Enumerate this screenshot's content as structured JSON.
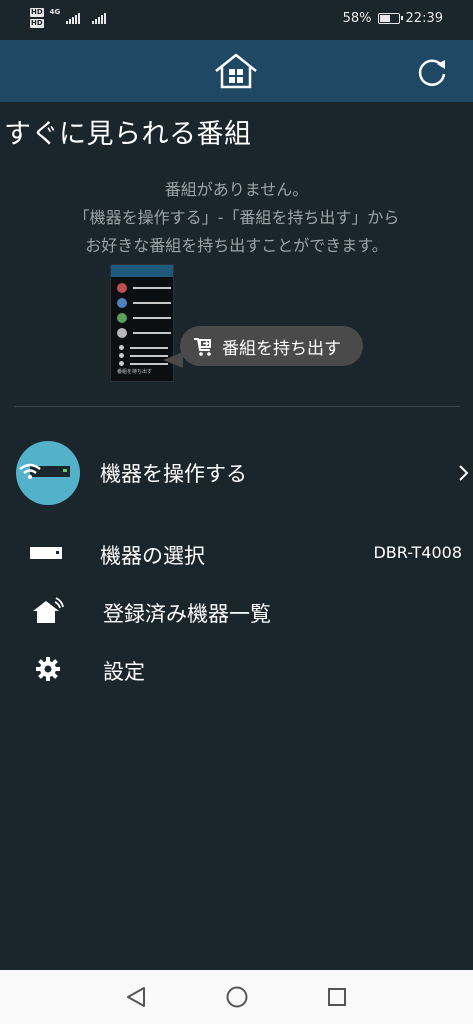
{
  "status": {
    "network_badge_1": "HD",
    "network_badge_2": "HD",
    "network_type": "4G",
    "battery": "58%",
    "time": "22:39"
  },
  "header": {
    "home_icon": "home-icon",
    "refresh_icon": "refresh-icon"
  },
  "section": {
    "title": "すぐに見られる番組",
    "empty_line1": "番組がありません。",
    "empty_line2": "「機器を操作する」-「番組を持ち出す」から",
    "empty_line3": "お好きな番組を持ち出すことができます。",
    "illustration_foot": "番組を持ち出す",
    "takeout_bubble": "番組を持ち出す"
  },
  "menu": {
    "operate": "機器を操作する",
    "select_device": "機器の選択",
    "selected_device": "DBR-T4008",
    "registered_devices": "登録済み機器一覧",
    "settings": "設定"
  },
  "colors": {
    "background": "#1b252c",
    "header": "#1f4864",
    "accent": "#53b2c9"
  }
}
